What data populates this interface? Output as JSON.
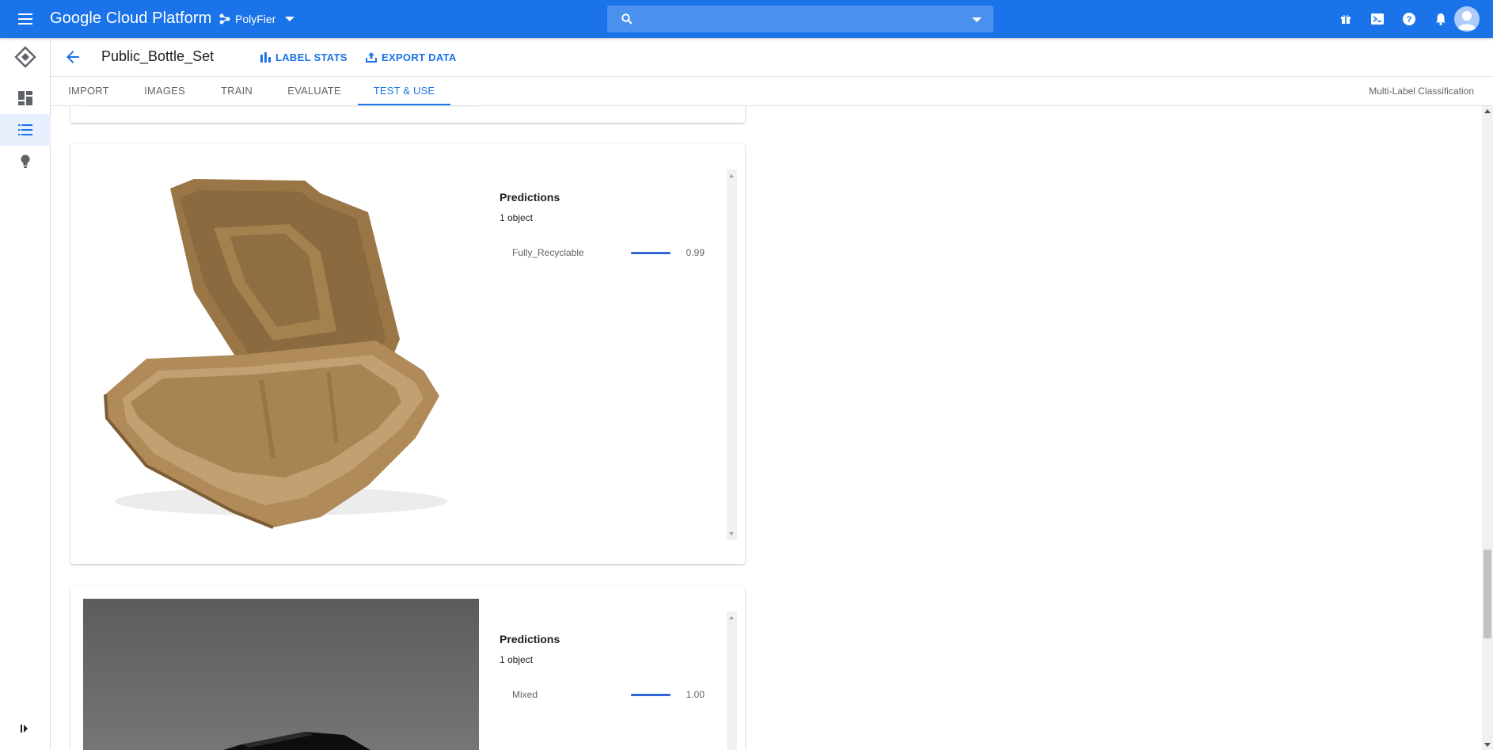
{
  "topbar": {
    "brand": "Google Cloud Platform",
    "project": "PolyFier",
    "search_placeholder": "",
    "icons": [
      "gift-icon",
      "terminal-icon",
      "help-icon",
      "notifications-icon",
      "more-vert-icon"
    ],
    "accent": "#1a73e8"
  },
  "rail": {
    "items": [
      "automl-logo-icon",
      "dashboard-icon",
      "datasets-list-icon",
      "lightbulb-icon"
    ],
    "expand_icon": "expand-rail-icon"
  },
  "header": {
    "title": "Public_Bottle_Set",
    "label_stats": "LABEL STATS",
    "export_data": "EXPORT DATA"
  },
  "tabs": {
    "items": [
      {
        "label": "IMPORT"
      },
      {
        "label": "IMAGES"
      },
      {
        "label": "TRAIN"
      },
      {
        "label": "EVALUATE"
      },
      {
        "label": "TEST & USE"
      }
    ],
    "active": "TEST & USE",
    "mode": "Multi-Label Classification"
  },
  "results": [
    {
      "image": "clamshell-takeout-container",
      "predictions_title": "Predictions",
      "object_count": "1 object",
      "labels": [
        {
          "name": "Fully_Recyclable",
          "score": "0.99",
          "fraction": 0.99
        }
      ]
    },
    {
      "image": "black-tray-dark-background",
      "predictions_title": "Predictions",
      "object_count": "1 object",
      "labels": [
        {
          "name": "Mixed",
          "score": "1.00",
          "fraction": 1.0
        }
      ]
    }
  ]
}
